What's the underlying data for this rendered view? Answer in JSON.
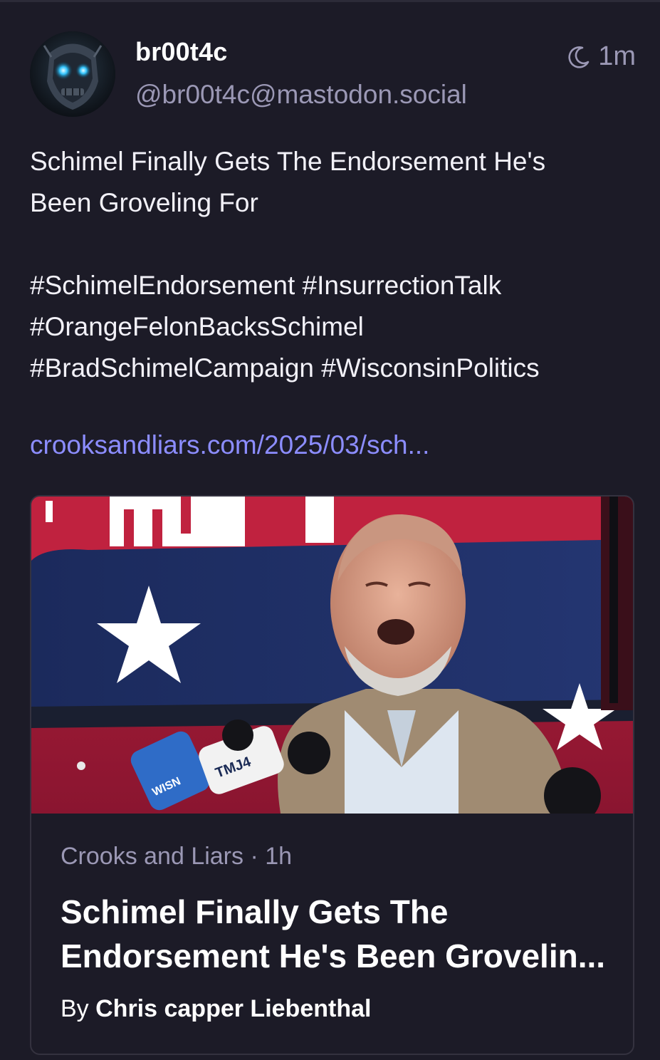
{
  "post": {
    "author": {
      "display_name": "br00t4c",
      "handle": "@br00t4c@mastodon.social"
    },
    "timestamp": "1m",
    "time_icon": "moon-icon",
    "text_lines": [
      "Schimel Finally Gets The Endorsement He's",
      "Been Groveling For"
    ],
    "hashtag_lines": [
      "#SchimelEndorsement #InsurrectionTalk",
      "#OrangeFelonBacksSchimel",
      "#BradSchimelCampaign #WisconsinPolitics"
    ],
    "link": "crooksandliars.com/2025/03/sch..."
  },
  "card": {
    "source": "Crooks and Liars",
    "separator": " · ",
    "age": "1h",
    "title_lines": [
      "Schimel Finally Gets The",
      "Endorsement He's Been Grovelin..."
    ],
    "byline_prefix": "By ",
    "byline_name": "Chris capper Liebenthal",
    "image_labels": {
      "mic1": "WISN",
      "mic2": "TMJ4"
    }
  },
  "colors": {
    "background": "#1c1b27",
    "accent_link": "#8c8dff",
    "muted_text": "#9b98b5"
  }
}
